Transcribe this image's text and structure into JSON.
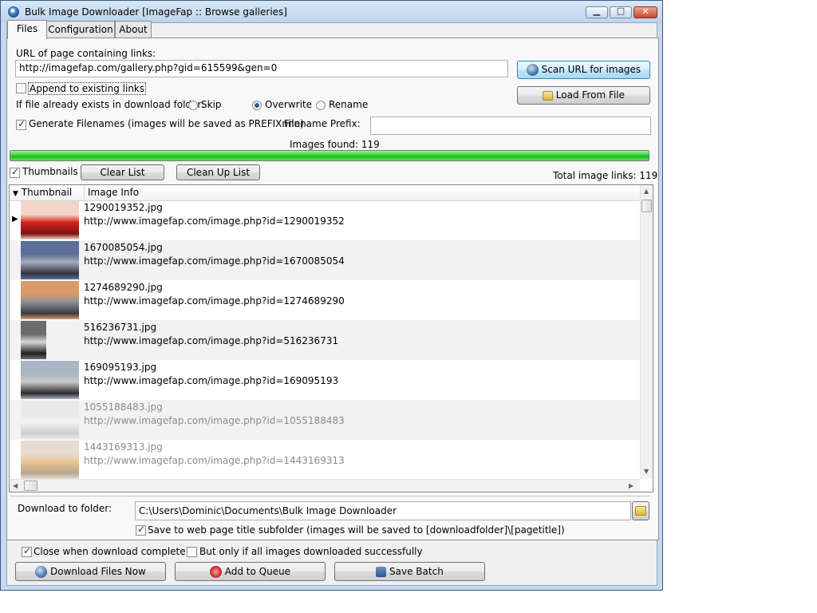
{
  "window": {
    "title": "Bulk Image Downloader [ImageFap :: Browse galleries]"
  },
  "tabs": [
    {
      "label": "Files"
    },
    {
      "label": "Configuration"
    },
    {
      "label": "About"
    }
  ],
  "files": {
    "url_label": "URL of page containing links:",
    "url_value": "http://imagefap.com/gallery.php?gid=615599&gen=0",
    "scan_button": "Scan URL for images",
    "load_button": "Load From File",
    "append_label": "Append to existing links",
    "append_checked": false,
    "exists_label": "If file already exists in download folder:",
    "exists_options": [
      {
        "label": "Skip",
        "selected": false
      },
      {
        "label": "Overwrite",
        "selected": true
      },
      {
        "label": "Rename",
        "selected": false
      }
    ],
    "generate_label": "Generate Filenames (images will be saved as PREFIXnnn)",
    "generate_checked": true,
    "prefix_label": "Filename Prefix:",
    "prefix_value": "",
    "images_found": "Images found: 119",
    "progress": 1.0,
    "thumbnails_label": "Thumbnails",
    "thumbnails_checked": true,
    "clear_list_button": "Clear List",
    "clean_up_list_button": "Clean Up List",
    "total_links": "Total image links: 119",
    "columns": [
      "Thumbnail",
      "Image Info"
    ],
    "rows": [
      {
        "name": "1290019352.jpg",
        "url": "http://www.imagefap.com/image.php?id=1290019352",
        "faded": false,
        "thumb_colors": [
          "#f2d4c8",
          "#d9221e",
          "#7a1510"
        ]
      },
      {
        "name": "1670085054.jpg",
        "url": "http://www.imagefap.com/image.php?id=1670085054",
        "faded": false,
        "thumb_colors": [
          "#5c6f99",
          "#a7adb8",
          "#2f3441"
        ]
      },
      {
        "name": "1274689290.jpg",
        "url": "http://www.imagefap.com/image.php?id=1274689290",
        "faded": false,
        "thumb_colors": [
          "#d99a6c",
          "#8c8f98",
          "#3a3a3f"
        ]
      },
      {
        "name": "516236731.jpg",
        "url": "http://www.imagefap.com/image.php?id=516236731",
        "faded": false,
        "thumb_colors": [
          "#6c6c6c",
          "#d8d8d8",
          "#1f1f1f"
        ]
      },
      {
        "name": "169095193.jpg",
        "url": "http://www.imagefap.com/image.php?id=169095193",
        "faded": false,
        "thumb_colors": [
          "#aab6c4",
          "#c9c9c9",
          "#2a2a2a"
        ]
      },
      {
        "name": "1055188483.jpg",
        "url": "http://www.imagefap.com/image.php?id=1055188483",
        "faded": true,
        "thumb_colors": [
          "#e8e8e8",
          "#f4f4f4",
          "#cfcfcf"
        ]
      },
      {
        "name": "1443169313.jpg",
        "url": "http://www.imagefap.com/image.php?id=1443169313",
        "faded": true,
        "thumb_colors": [
          "#e6ddd0",
          "#e8c690",
          "#b8a78e"
        ]
      }
    ]
  },
  "download": {
    "folder_label": "Download to folder:",
    "folder_value": "C:\\Users\\Dominic\\Documents\\Bulk Image Downloader",
    "subfolder_label": "Save to web page title subfolder (images will be saved to [downloadfolder]\\[pagetitle])",
    "subfolder_checked": true
  },
  "bottom": {
    "close_label": "Close when download complete",
    "close_checked": true,
    "only_if_label": "But only if all images downloaded successfully",
    "only_if_checked": false,
    "download_button": "Download Files Now",
    "queue_button": "Add to Queue",
    "save_batch_button": "Save Batch"
  },
  "colors": {
    "accent": "#3c7fb1",
    "progress": "#19b919",
    "title_bar": "#bcd2ec"
  }
}
